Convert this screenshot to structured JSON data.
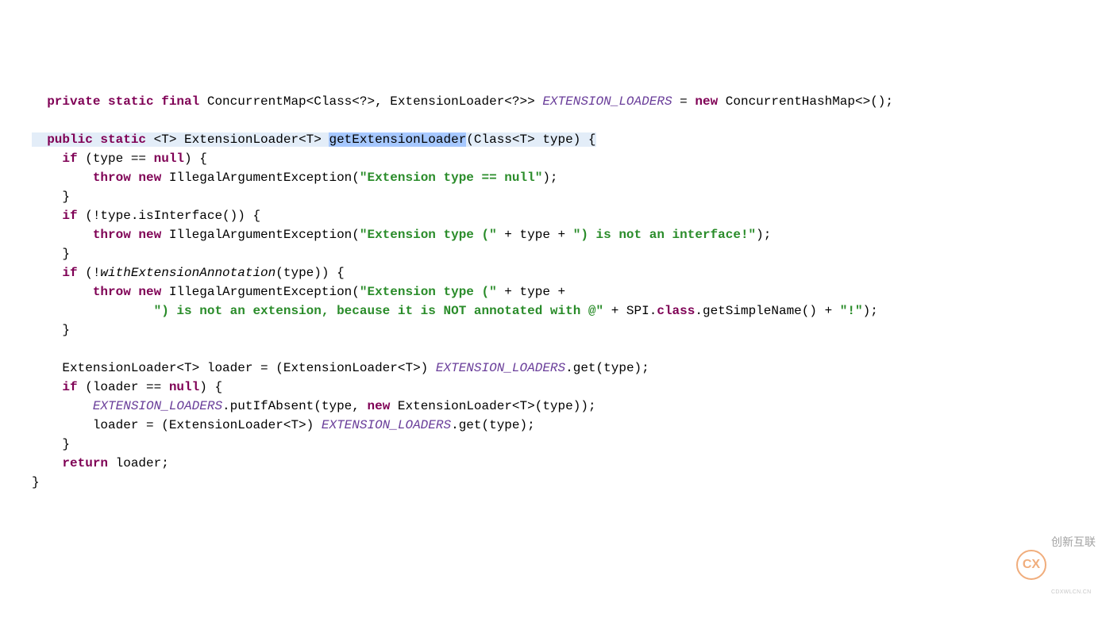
{
  "code": {
    "l1": {
      "a": "private static final",
      "b": " ConcurrentMap<Class<?>, ExtensionLoader<?>> ",
      "c": "EXTENSION_LOADERS",
      "d": " = ",
      "e": "new",
      "f": " ConcurrentHashMap<>();"
    },
    "l2": {
      "a": "public static",
      "b": " <T> ExtensionLoader<T> ",
      "c": "getExtensionLoader",
      "d": "(Class<T> type) {"
    },
    "l3": {
      "a": "if",
      "b": " (type == ",
      "c": "null",
      "d": ") {"
    },
    "l4": {
      "a": "throw new",
      "b": " IllegalArgumentException(",
      "c": "\"Extension type == null\"",
      "d": ");"
    },
    "l5": "    }",
    "l6": {
      "a": "if",
      "b": " (!type.isInterface()) {"
    },
    "l7": {
      "a": "throw new",
      "b": " IllegalArgumentException(",
      "c": "\"Extension type (\"",
      "d": " + type + ",
      "e": "\") is not an interface!\"",
      "f": ");"
    },
    "l8": "    }",
    "l9": {
      "a": "if",
      "b": " (!",
      "c": "withExtensionAnnotation",
      "d": "(type)) {"
    },
    "l10": {
      "a": "throw new",
      "b": " IllegalArgumentException(",
      "c": "\"Extension type (\"",
      "d": " + type +"
    },
    "l11": {
      "a": "\") is not an extension, because it is NOT annotated with @\"",
      "b": " + SPI.",
      "c": "class",
      "d": ".getSimpleName() + ",
      "e": "\"!\"",
      "f": ");"
    },
    "l12": "    }",
    "l13": "",
    "l14": {
      "a": "    ExtensionLoader<T> loader = (ExtensionLoader<T>) ",
      "b": "EXTENSION_LOADERS",
      "c": ".get(type);"
    },
    "l15": {
      "a": "if",
      "b": " (loader == ",
      "c": "null",
      "d": ") {"
    },
    "l16": {
      "a": "EXTENSION_LOADERS",
      "b": ".putIfAbsent(type, ",
      "c": "new",
      "d": " ExtensionLoader<T>(type));"
    },
    "l17": {
      "a": "        loader = (ExtensionLoader<T>) ",
      "b": "EXTENSION_LOADERS",
      "c": ".get(type);"
    },
    "l18": "    }",
    "l19": {
      "a": "return",
      "b": " loader;"
    },
    "l20": "}"
  },
  "watermark": {
    "logo": "CX",
    "text": "创新互联",
    "sub": "CDXWLCN.CN"
  }
}
